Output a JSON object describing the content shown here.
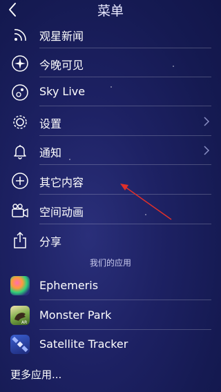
{
  "header": {
    "title": "菜单"
  },
  "menu": [
    {
      "label": "观星新闻",
      "icon": "rss-icon"
    },
    {
      "label": "今晚可见",
      "icon": "compass-star-icon"
    },
    {
      "label": "Sky Live",
      "icon": "planet-phase-icon"
    },
    {
      "label": "设置",
      "icon": "gear-icon",
      "chevron": true
    },
    {
      "label": "通知",
      "icon": "bell-icon",
      "chevron": true
    },
    {
      "label": "其它内容",
      "icon": "plus-circle-icon"
    },
    {
      "label": "空间动画",
      "icon": "video-camera-icon"
    },
    {
      "label": "分享",
      "icon": "share-icon"
    }
  ],
  "apps_section": {
    "title": "我们的应用"
  },
  "apps": [
    {
      "label": "Ephemeris",
      "icon": "ephemeris-app-icon"
    },
    {
      "label": "Monster Park",
      "icon": "monster-park-app-icon"
    },
    {
      "label": "Satellite Tracker",
      "icon": "satellite-tracker-app-icon"
    }
  ],
  "more_apps": {
    "label": "更多应用..."
  },
  "colors": {
    "background": "#1d2163",
    "annotation_arrow": "#e0302a"
  }
}
